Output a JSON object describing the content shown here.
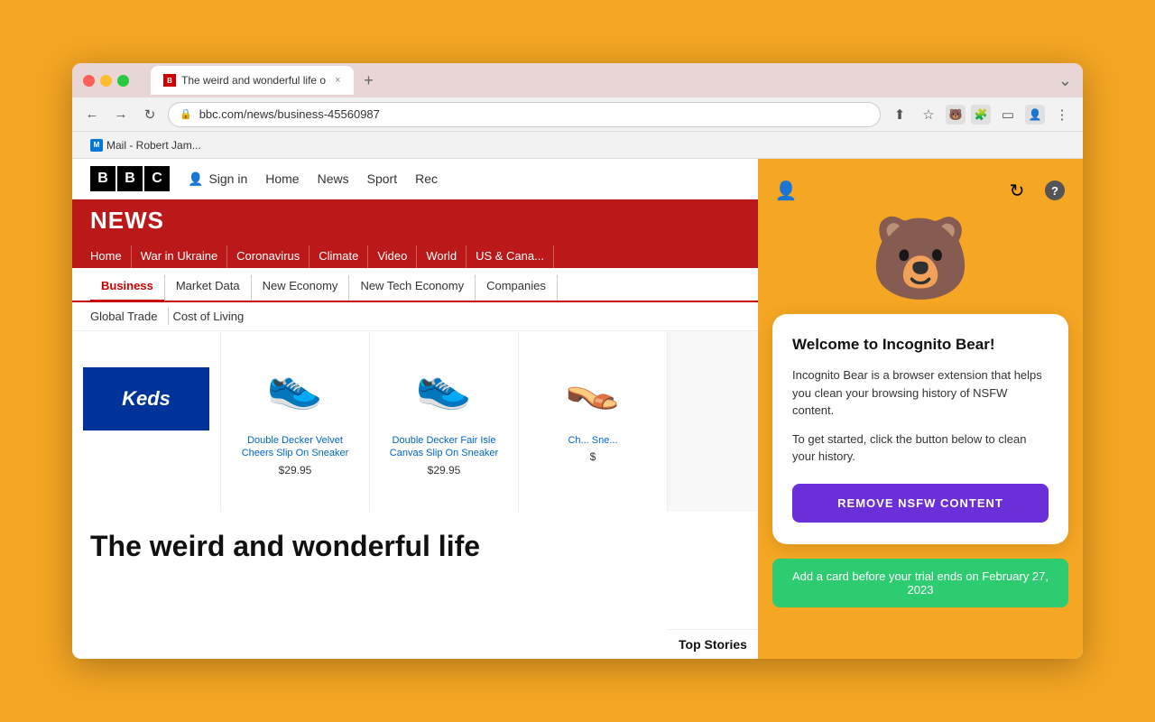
{
  "browser": {
    "tab_label": "The weird and wonderful life o",
    "tab_close": "×",
    "tab_add": "+",
    "url": "bbc.com/news/business-45560987",
    "window_collapse": "⌄",
    "nav_back": "←",
    "nav_forward": "→",
    "nav_refresh": "↻",
    "nav_lock": "🔒",
    "bookmark_label": "Mail - Robert Jam..."
  },
  "bbc": {
    "logo_letters": [
      "B",
      "B",
      "C"
    ],
    "signin_label": "Sign in",
    "nav_items": [
      "Home",
      "News",
      "Sport",
      "Rec"
    ],
    "news_title": "NEWS",
    "subnav_items": [
      "Home",
      "War in Ukraine",
      "Coronavirus",
      "Climate",
      "Video",
      "World",
      "US & Cana..."
    ],
    "biz_nav_items": [
      "Business",
      "Market Data",
      "New Economy",
      "New Tech Economy",
      "Companies"
    ],
    "biz_nav2_items": [
      "Global Trade",
      "Cost of Living"
    ],
    "keds_label": "Keds",
    "products": [
      {
        "emoji": "👟",
        "name": "Double Decker Velvet Cheers Slip On Sneaker",
        "price": "$29.95"
      },
      {
        "emoji": "👟",
        "name": "Double Decker Fair Isle Canvas Slip On Sneaker",
        "price": "$29.95"
      },
      {
        "emoji": "👡",
        "name": "Ch... Sne...",
        "price": "$"
      }
    ],
    "headline": "The weird and wonderful life",
    "top_stories": "Top Stories"
  },
  "extension": {
    "user_icon": "👤",
    "refresh_icon": "↻",
    "help_icon": "?",
    "bear_emoji": "🐻",
    "card_title": "Welcome to Incognito Bear!",
    "card_desc1": "Incognito Bear is a browser extension that helps you clean your browsing history of NSFW content.",
    "card_desc2": "To get started, click the button below to clean your history.",
    "remove_btn_label": "REMOVE NSFW CONTENT",
    "trial_banner": "Add a card before your trial ends on February 27, 2023"
  }
}
